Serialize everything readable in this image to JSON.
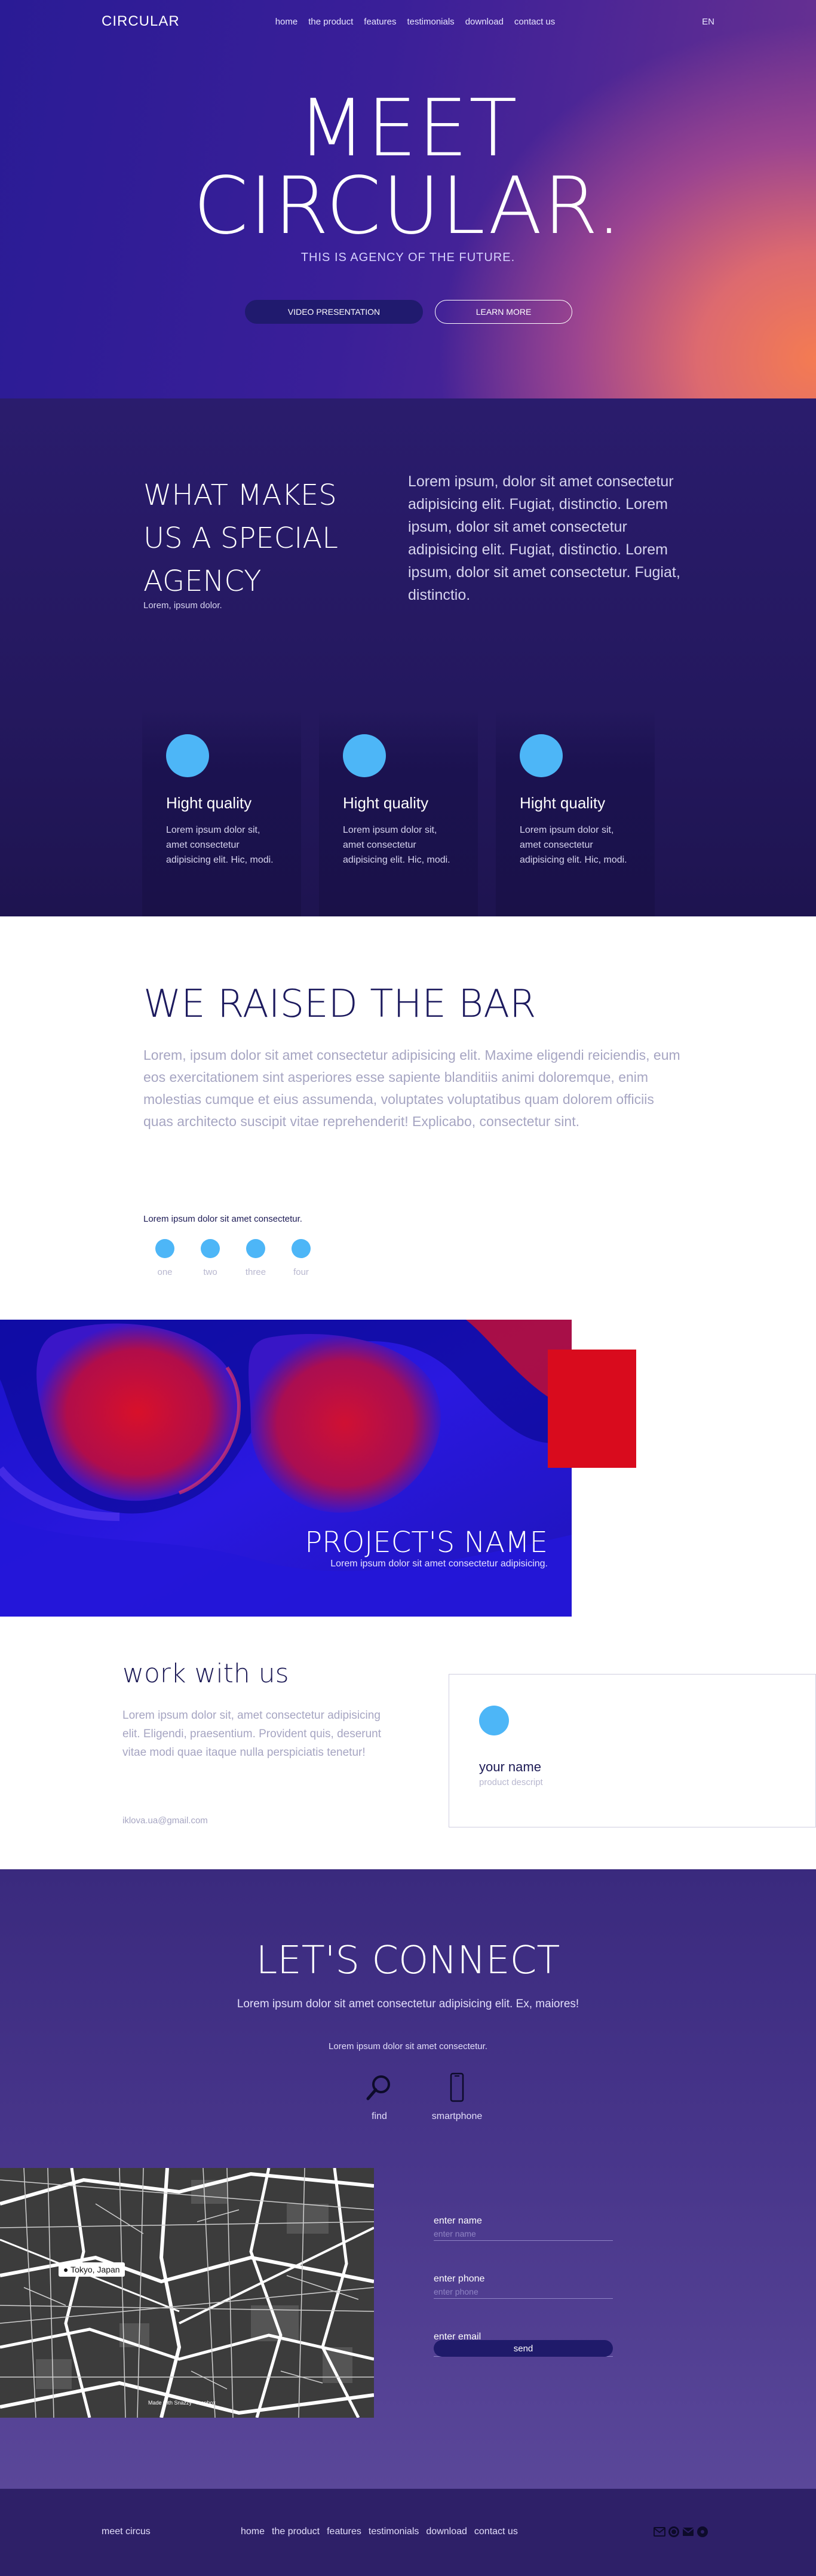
{
  "header": {
    "logo": "CIRCULAR",
    "nav": [
      "home",
      "the product",
      "features",
      "testimonials",
      "download",
      "contact us"
    ],
    "lang": "EN"
  },
  "hero": {
    "title_line1": "MEET",
    "title_line2": "CIRCULAR.",
    "subtitle": "THIS IS AGENCY OF THE FUTURE.",
    "video_button": "VIDEO PRESENTATION",
    "learn_button": "LEARN MORE"
  },
  "special": {
    "title": "WHAT MAKES US A SPECIAL AGENCY",
    "small": "Lorem, ipsum dolor.",
    "text": "Lorem ipsum, dolor sit amet consectetur adipisicing elit. Fugiat, distinctio. Lorem ipsum, dolor sit amet consectetur adipisicing elit. Fugiat, distinctio. Lorem ipsum, dolor sit amet consectetur. Fugiat, distinctio.",
    "cards": [
      {
        "title": "Hight quality",
        "text": "Lorem ipsum dolor sit, amet consectetur adipisicing elit. Hic, modi."
      },
      {
        "title": "Hight quality",
        "text": "Lorem ipsum dolor sit, amet consectetur adipisicing elit. Hic, modi."
      },
      {
        "title": "Hight quality",
        "text": "Lorem ipsum dolor sit, amet consectetur adipisicing elit. Hic, modi."
      }
    ]
  },
  "bar": {
    "title": "WE RAISED THE BAR",
    "text": "Lorem, ipsum dolor sit amet consectetur adipisicing elit. Maxime eligendi reiciendis, eum eos exercitationem sint asperiores esse sapiente blanditiis animi doloremque, enim molestias cumque et eius assumenda, voluptates voluptatibus quam dolorem officiis quas architecto suscipit vitae reprehenderit! Explicabo, consectetur sint.",
    "small": "Lorem ipsum dolor sit amet consectetur.",
    "steps": [
      "one",
      "two",
      "three",
      "four"
    ]
  },
  "project": {
    "name": "PROJECT'S NAME",
    "sub": "Lorem ipsum dolor sit amet consectetur adipisicing."
  },
  "work": {
    "title": "work with us",
    "text": "Lorem ipsum dolor sit, amet consectetur adipisicing elit. Eligendi, praesentium. Provident quis, deserunt vitae modi quae itaque nulla perspiciatis tenetur!",
    "email": "iklova.ua@gmail.com",
    "product_name": "your name",
    "product_desc": "product descript"
  },
  "connect": {
    "title": "LET'S CONNECT",
    "subtitle": "Lorem ipsum dolor sit amet consectetur adipisicing elit. Ex, maiores!",
    "small": "Lorem ipsum dolor sit amet consectetur.",
    "contacts": [
      "find",
      "smartphone"
    ],
    "map_label": "Tokyo, Japan",
    "map_credit": "Made with Snazzy · mapbox",
    "fields": [
      {
        "label": "enter name",
        "placeholder": "enter name"
      },
      {
        "label": "enter phone",
        "placeholder": "enter phone"
      },
      {
        "label": "enter email",
        "placeholder": "enter email"
      }
    ],
    "send": "send"
  },
  "footer": {
    "brand": "meet circus",
    "nav": [
      "home",
      "the product",
      "features",
      "testimonials",
      "download",
      "contact us"
    ],
    "social_icons": [
      "mail-icon",
      "messenger-icon",
      "mail-icon",
      "circle-icon"
    ]
  },
  "colors": {
    "accent_blue": "#4db6f7",
    "deep_navy": "#1c1a55",
    "button_dark": "#201a6e",
    "project_red": "#d90b1d"
  }
}
